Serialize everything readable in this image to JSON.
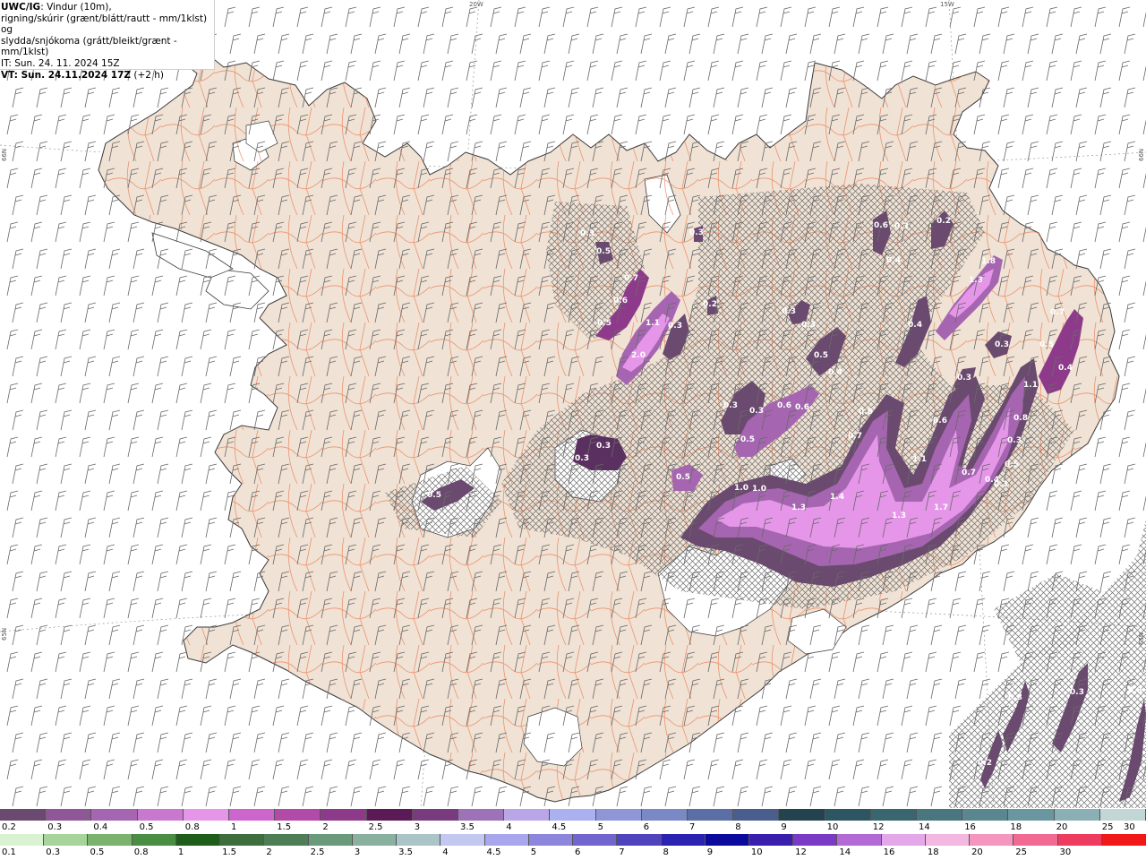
{
  "header": {
    "model_label": "UWC/IG",
    "line1_rest": ": Vindur (10m),",
    "line2": "rigning/skúrir (grænt/blátt/rautt - mm/1klst) og",
    "line3": "slydda/snjókoma (grátt/bleikt/grænt - mm/1klst)",
    "init_time": "IT: Sun. 24. 11. 2024 15Z",
    "valid_prefix": "VT: Sun. 24.11.2024 17Z",
    "valid_offset": " (+2 h)"
  },
  "grid_labels": {
    "lon_20w": "20W",
    "lon_15w": "15W",
    "lat_66n_left": "66N",
    "lat_66n_right": "66N",
    "lat_65n_left": "65N",
    "lat_65n_right": "65N"
  },
  "legend_snow": {
    "colors": [
      "#6a4a6e",
      "#8e5796",
      "#a665b0",
      "#c879cf",
      "#e596e9",
      "#cc66cc",
      "#b24aa8",
      "#8e3a8a",
      "#5a1a56",
      "#7a3a7e",
      "#9e72b6",
      "#b8a6e6",
      "#aab0f0",
      "#8e96d8",
      "#7a88c6",
      "#5c6ea6",
      "#4a5e8e",
      "#23434f",
      "#2e5662",
      "#3a6670",
      "#4a7680",
      "#5a8690",
      "#6a96a0",
      "#8ab0b6",
      "#c2d6d6"
    ],
    "labels": [
      "0.2",
      "0.3",
      "0.4",
      "0.5",
      "0.8",
      "1",
      "1.5",
      "2",
      "2.5",
      "3",
      "3.5",
      "4",
      "4.5",
      "5",
      "6",
      "7",
      "8",
      "9",
      "10",
      "12",
      "14",
      "16",
      "18",
      "20",
      "25",
      "30"
    ]
  },
  "legend_rain": {
    "colors": [
      "#d8f2d2",
      "#a6d49a",
      "#7ab26e",
      "#4a8e44",
      "#1e5e1a",
      "#3e6e3e",
      "#4e7e56",
      "#6a9a7a",
      "#8ab0a0",
      "#aac4c8",
      "#c2c8f0",
      "#a8a6ec",
      "#8e86dc",
      "#7266ce",
      "#5044be",
      "#2a22b0",
      "#0c0a9c",
      "#3a1eae",
      "#7a3ac6",
      "#b46ad6",
      "#e4a8ea",
      "#f2b8e2",
      "#f496c0",
      "#f06a94",
      "#ee3c60",
      "#f01818"
    ],
    "labels": [
      "0.1",
      "0.3",
      "0.5",
      "0.8",
      "1",
      "1.5",
      "2",
      "2.5",
      "3",
      "3.5",
      "4",
      "4.5",
      "5",
      "6",
      "7",
      "8",
      "9",
      "10",
      "12",
      "14",
      "16",
      "18",
      "20",
      "25",
      "30"
    ]
  },
  "precip_values": [
    {
      "text": "0.3"
    },
    {
      "text": "0.5"
    },
    {
      "text": "0.7"
    },
    {
      "text": "0.6"
    },
    {
      "text": "0.5"
    },
    {
      "text": "1.1"
    },
    {
      "text": "0.3"
    },
    {
      "text": "2.0"
    },
    {
      "text": "0.3"
    },
    {
      "text": "0.2"
    },
    {
      "text": "0.3"
    },
    {
      "text": "0.3"
    },
    {
      "text": "0.5"
    },
    {
      "text": "0.4"
    },
    {
      "text": "0.6"
    },
    {
      "text": "0.3"
    },
    {
      "text": "0.4"
    },
    {
      "text": "0.2"
    },
    {
      "text": "1.8"
    },
    {
      "text": "1.3"
    },
    {
      "text": "0.4"
    },
    {
      "text": "0.3"
    },
    {
      "text": "0.7"
    },
    {
      "text": "0.5"
    },
    {
      "text": "0.4"
    },
    {
      "text": "0.3"
    },
    {
      "text": "1.1"
    },
    {
      "text": "0.3"
    },
    {
      "text": "0.3"
    },
    {
      "text": "0.6"
    },
    {
      "text": "0.6"
    },
    {
      "text": "0.6"
    },
    {
      "text": "0.5"
    },
    {
      "text": "0.7"
    },
    {
      "text": "0.6"
    },
    {
      "text": "0.8"
    },
    {
      "text": "0.3"
    },
    {
      "text": "0.3"
    },
    {
      "text": "0.5"
    },
    {
      "text": "1.0"
    },
    {
      "text": "1.0"
    },
    {
      "text": "1.1"
    },
    {
      "text": "0.7"
    },
    {
      "text": "0.4"
    },
    {
      "text": "0.5"
    },
    {
      "text": "0.3"
    },
    {
      "text": "0.3"
    },
    {
      "text": "0.5"
    },
    {
      "text": "1.3"
    },
    {
      "text": "1.4"
    },
    {
      "text": "1.3"
    },
    {
      "text": "1.7"
    },
    {
      "text": "0.3"
    },
    {
      "text": "0.3"
    },
    {
      "text": "0.2"
    },
    {
      "text": "0.3"
    }
  ]
}
